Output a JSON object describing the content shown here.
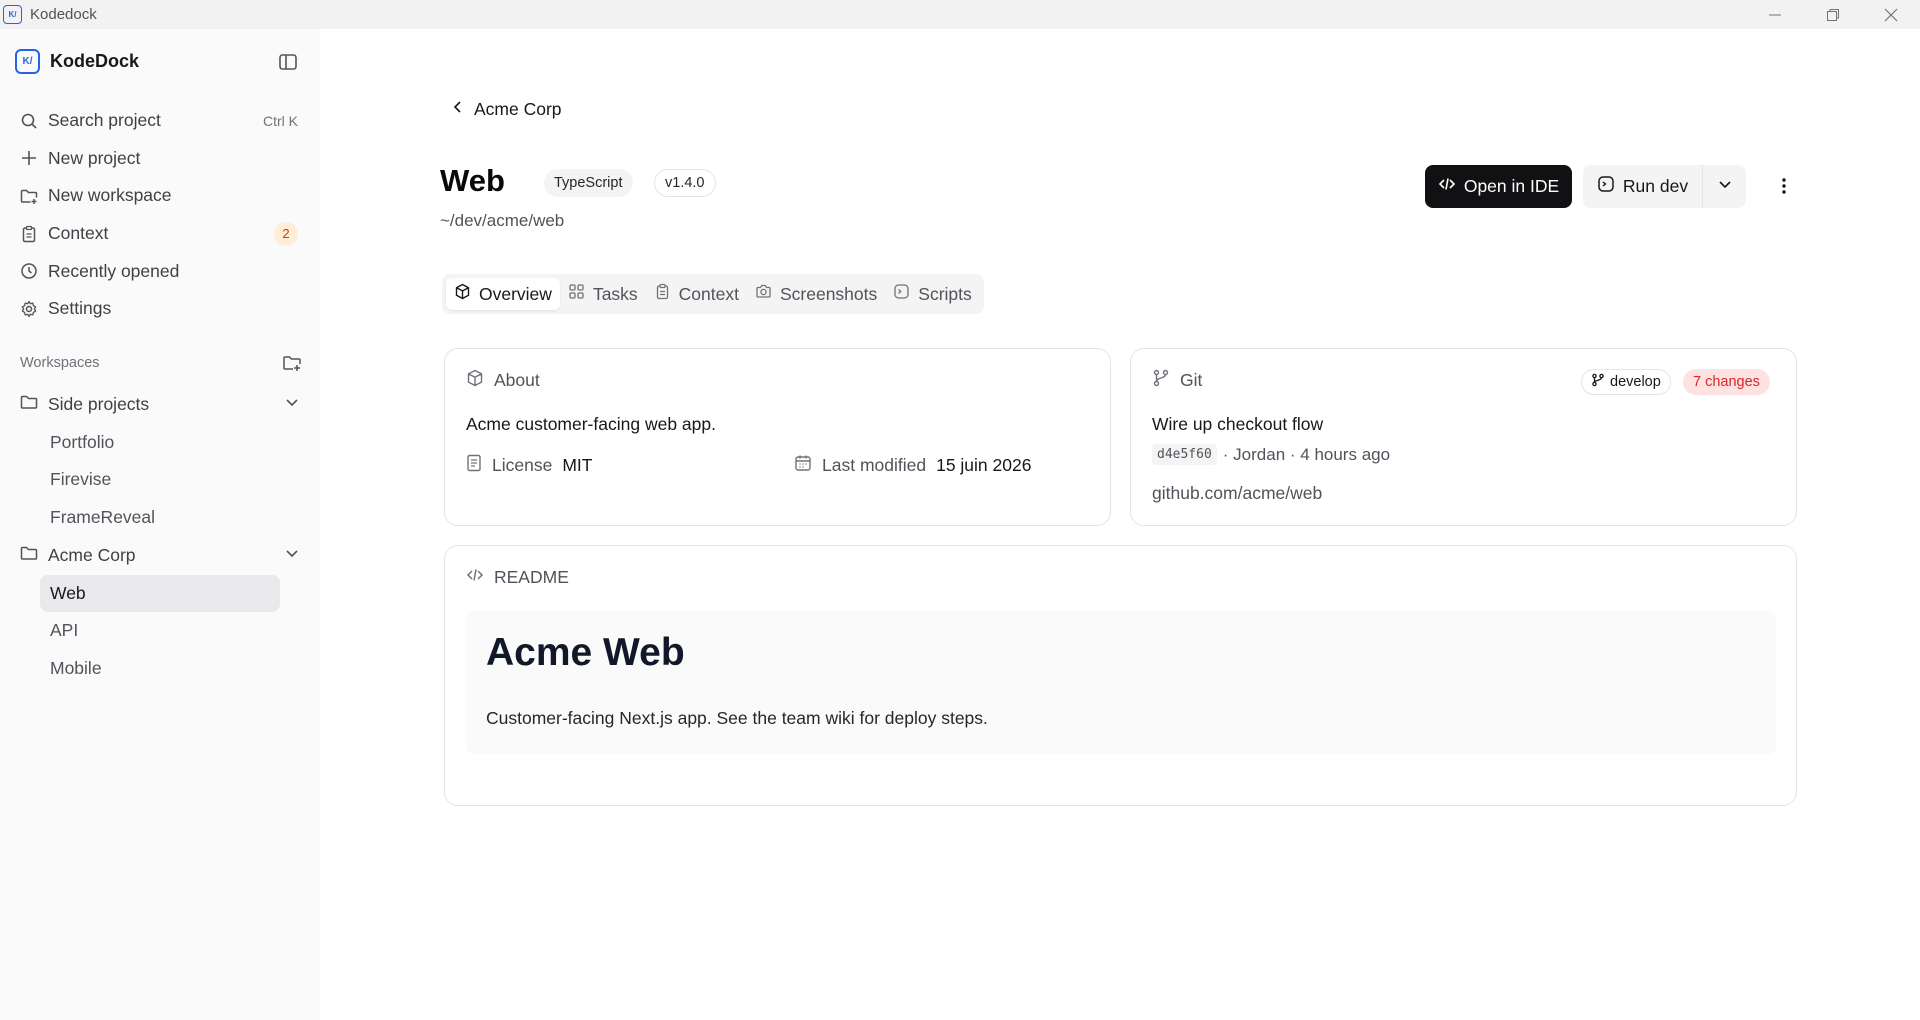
{
  "window": {
    "title": "Kodedock",
    "app_icon": "code-icon"
  },
  "sidebar": {
    "brand": "KodeDock",
    "nav": [
      {
        "label": "Search project",
        "icon": "search-icon",
        "shortcut": "Ctrl K"
      },
      {
        "label": "New project",
        "icon": "plus-icon"
      },
      {
        "label": "New workspace",
        "icon": "folder-plus-icon"
      },
      {
        "label": "Context",
        "icon": "clipboard-icon",
        "badge": "2"
      },
      {
        "label": "Recently opened",
        "icon": "clock-icon"
      },
      {
        "label": "Settings",
        "icon": "gear-icon"
      }
    ],
    "workspaces_label": "Workspaces",
    "workspaces": [
      {
        "name": "Side projects",
        "expanded": true,
        "projects": [
          "Portfolio",
          "Firevise",
          "FrameReveal"
        ]
      },
      {
        "name": "Acme Corp",
        "expanded": true,
        "projects": [
          "Web",
          "API",
          "Mobile"
        ],
        "active": "Web"
      }
    ]
  },
  "main": {
    "back_label": "Acme Corp",
    "project": {
      "name": "Web",
      "language": "TypeScript",
      "version": "v1.4.0",
      "path": "~/dev/acme/web"
    },
    "actions": {
      "open_ide": "Open in IDE",
      "run": "Run dev"
    },
    "tabs": [
      {
        "label": "Overview",
        "icon": "package-icon",
        "active": true
      },
      {
        "label": "Tasks",
        "icon": "grid-icon"
      },
      {
        "label": "Context",
        "icon": "clipboard-icon"
      },
      {
        "label": "Screenshots",
        "icon": "camera-icon"
      },
      {
        "label": "Scripts",
        "icon": "terminal-icon"
      }
    ],
    "about": {
      "title": "About",
      "description": "Acme customer-facing web app.",
      "license_label": "License",
      "license": "MIT",
      "modified_label": "Last modified",
      "modified": "15 juin 2026"
    },
    "git": {
      "title": "Git",
      "branch": "develop",
      "changes": "7 changes",
      "commit_message": "Wire up checkout flow",
      "commit_hash": "d4e5f60",
      "commit_meta": "· Jordan · 4 hours ago",
      "remote": "github.com/acme/web"
    },
    "readme": {
      "title": "README",
      "heading": "Acme Web",
      "body": "Customer-facing Next.js app. See the team wiki for deploy steps."
    }
  },
  "colors": {
    "accent": "#2563eb",
    "primary_button": "#111113",
    "changes_badge": "#dc2626",
    "context_badge": "#c2410c"
  }
}
